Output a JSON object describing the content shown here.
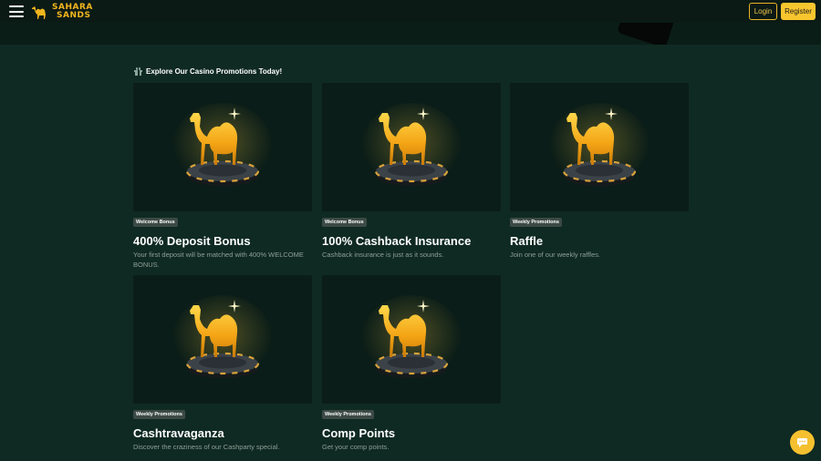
{
  "header": {
    "brand_line1": "SAHARA",
    "brand_line2": "SANDS",
    "login_label": "Login",
    "register_label": "Register"
  },
  "section": {
    "title": "Explore Our Casino Promotions Today!"
  },
  "promotions": [
    {
      "badge": "Welcome Bonus",
      "title": "400% Deposit Bonus",
      "description": "Your first deposit will be matched with 400% WELCOME BONUS."
    },
    {
      "badge": "Welcome Bonus",
      "title": "100% Cashback Insurance",
      "description": "Cashback insurance is just as it sounds."
    },
    {
      "badge": "Weekly Promotions",
      "title": "Raffle",
      "description": "Join one of our weekly raffles."
    },
    {
      "badge": "Weekly Promotions",
      "title": "Cashtravaganza",
      "description": "Discover the craziness of our Cashparty special."
    },
    {
      "badge": "Weekly Promotions",
      "title": "Comp Points",
      "description": "Get your comp points."
    }
  ],
  "colors": {
    "background": "#0f2a22",
    "topbar": "#0b1a15",
    "accent": "#f7c52e",
    "card": "#0b1d18",
    "badge": "#3c4a45"
  },
  "icons": {
    "menu": "hamburger-menu-icon",
    "logo": "camel-logo-icon",
    "section": "gift-icon",
    "card_image": "golden-camel-on-chip-icon",
    "chat": "chat-bubble-icon"
  }
}
